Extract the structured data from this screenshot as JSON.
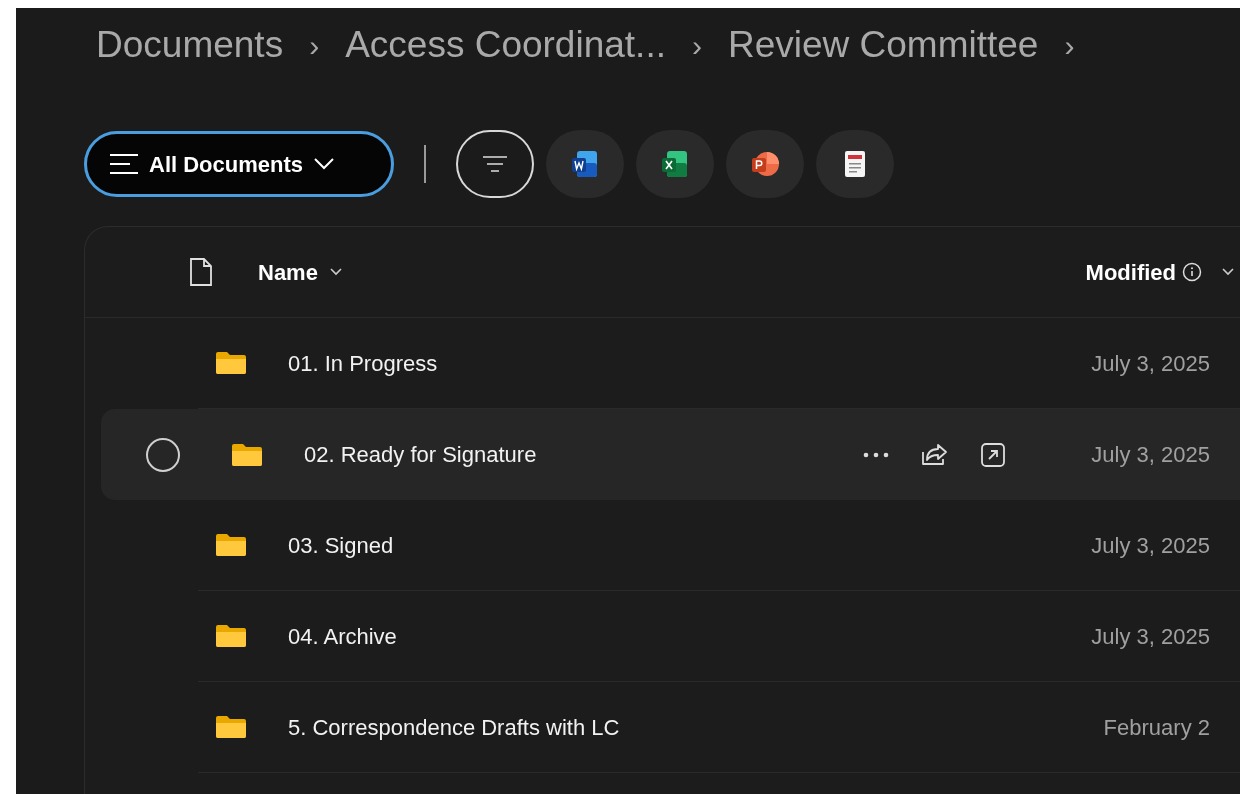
{
  "breadcrumb": [
    {
      "label": "Documents"
    },
    {
      "label": "Access Coordinat..."
    },
    {
      "label": "Review Committee"
    }
  ],
  "breadcrumb_separator": "›",
  "view_selector": {
    "label": "All Documents"
  },
  "file_type_filters": [
    {
      "kind": "word"
    },
    {
      "kind": "excel"
    },
    {
      "kind": "powerpoint"
    },
    {
      "kind": "pdf"
    }
  ],
  "table": {
    "columns": [
      {
        "label": "Name"
      },
      {
        "label": "Modified"
      }
    ],
    "rows": [
      {
        "name": "01. In Progress",
        "modified": "July 3, 2025",
        "hovered": false
      },
      {
        "name": "02. Ready for Signature",
        "modified": "July 3, 2025",
        "hovered": true
      },
      {
        "name": "03. Signed",
        "modified": "July 3, 2025",
        "hovered": false
      },
      {
        "name": "04. Archive",
        "modified": "July 3, 2025",
        "hovered": false
      },
      {
        "name": "5. Correspondence Drafts with LC",
        "modified": "February 2",
        "hovered": false
      }
    ]
  }
}
